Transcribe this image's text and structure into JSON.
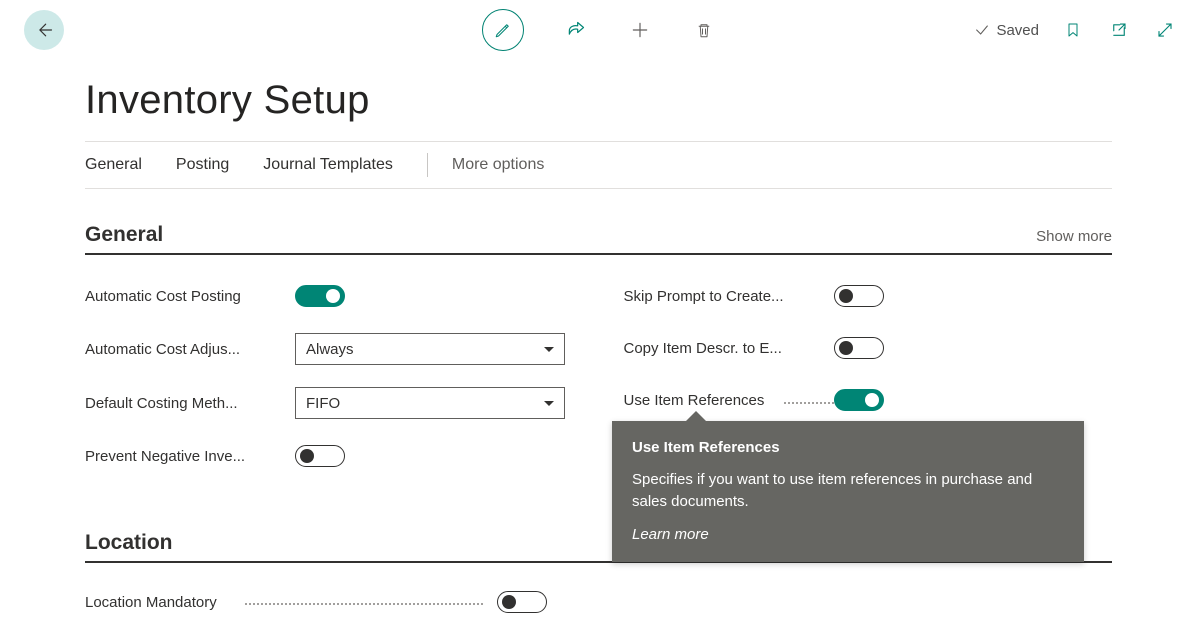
{
  "header": {
    "saved_label": "Saved"
  },
  "page": {
    "title": "Inventory Setup"
  },
  "tabs": {
    "general": "General",
    "posting": "Posting",
    "journal_templates": "Journal Templates",
    "more_options": "More options"
  },
  "sections": {
    "general": {
      "title": "General",
      "show_more": "Show more"
    },
    "location": {
      "title": "Location"
    }
  },
  "fields": {
    "automatic_cost_posting": {
      "label": "Automatic Cost Posting",
      "value": true
    },
    "automatic_cost_adjustment": {
      "label": "Automatic Cost Adjus...",
      "value": "Always"
    },
    "default_costing_method": {
      "label": "Default Costing Meth...",
      "value": "FIFO"
    },
    "prevent_negative_inventory": {
      "label": "Prevent Negative Inve...",
      "value": false
    },
    "skip_prompt_to_create": {
      "label": "Skip Prompt to Create...",
      "value": false
    },
    "copy_item_descr": {
      "label": "Copy Item Descr. to E...",
      "value": false
    },
    "use_item_references": {
      "label": "Use Item References",
      "value": true
    },
    "location_mandatory": {
      "label": "Location Mandatory",
      "value": false
    }
  },
  "tooltip": {
    "title": "Use Item References",
    "body": "Specifies if you want to use item references in purchase and sales documents.",
    "learn_more": "Learn more"
  }
}
